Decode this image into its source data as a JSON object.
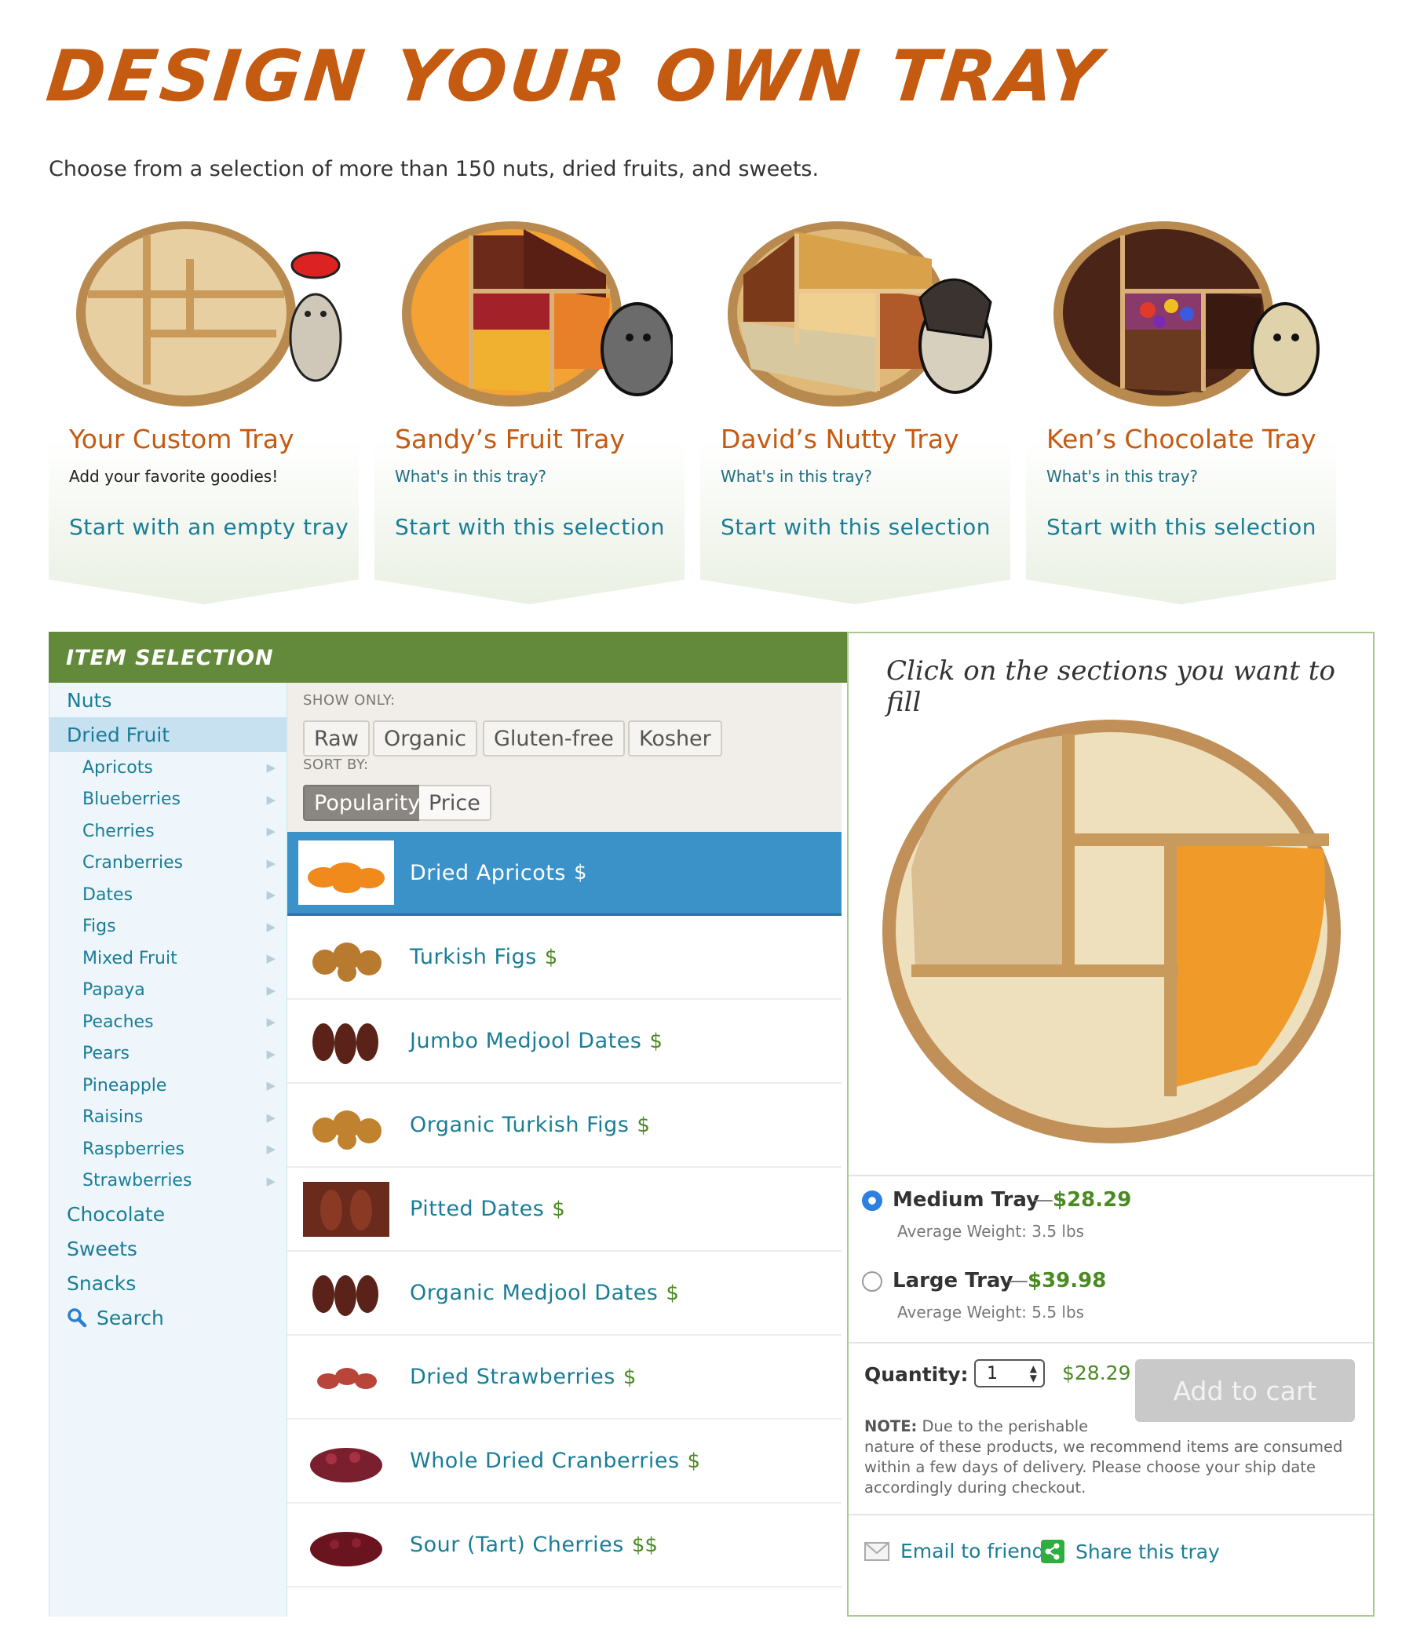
{
  "page": {
    "title": "DESIGN YOUR OWN TRAY",
    "subtitle": "Choose from a selection of more than 150 nuts, dried fruits, and sweets."
  },
  "trays": [
    {
      "title": "Your Custom Tray",
      "sub": "Add your favorite goodies!",
      "link": "Start with an empty tray"
    },
    {
      "title": "Sandy’s Fruit Tray",
      "sub": "What's in this tray?",
      "link": "Start with this selection"
    },
    {
      "title": "David’s Nutty Tray",
      "sub": "What's in this tray?",
      "link": "Start with this selection"
    },
    {
      "title": "Ken’s Chocolate Tray",
      "sub": "What's in this tray?",
      "link": "Start with this selection"
    }
  ],
  "selection": {
    "header": "ITEM SELECTION",
    "categories": {
      "nuts": "Nuts",
      "dried_fruit": "Dried Fruit",
      "chocolate": "Chocolate",
      "sweets": "Sweets",
      "snacks": "Snacks",
      "search": "Search"
    },
    "subcategories": [
      "Apricots",
      "Blueberries",
      "Cherries",
      "Cranberries",
      "Dates",
      "Figs",
      "Mixed Fruit",
      "Papaya",
      "Peaches",
      "Pears",
      "Pineapple",
      "Raisins",
      "Raspberries",
      "Strawberries"
    ],
    "show_only_label": "SHOW ONLY:",
    "filters": [
      "Raw",
      "Organic",
      "Gluten-free",
      "Kosher"
    ],
    "sort_label": "SORT BY:",
    "sort_options": [
      "Popularity",
      "Price"
    ],
    "products": [
      {
        "name": "Dried Apricots",
        "price": "$",
        "color": "#f08a1c"
      },
      {
        "name": "Turkish Figs",
        "price": "$",
        "color": "#b87a2e"
      },
      {
        "name": "Jumbo Medjool Dates",
        "price": "$",
        "color": "#5a2218"
      },
      {
        "name": "Organic Turkish Figs",
        "price": "$",
        "color": "#c0822e"
      },
      {
        "name": "Pitted Dates",
        "price": "$",
        "color": "#6a2a1c"
      },
      {
        "name": "Organic Medjool Dates",
        "price": "$",
        "color": "#5a2218"
      },
      {
        "name": "Dried Strawberries",
        "price": "$",
        "color": "#b8443a"
      },
      {
        "name": "Whole Dried Cranberries",
        "price": "$",
        "color": "#7a1f2e"
      },
      {
        "name": "Sour (Tart) Cherries",
        "price": "$$",
        "color": "#6a1420"
      }
    ]
  },
  "builder": {
    "hint": "Click on the sections you want to fill",
    "medium": {
      "name": "Medium Tray",
      "dash": "—",
      "price": "$28.29",
      "weight": "Average Weight: 3.5 lbs",
      "selected": true
    },
    "large": {
      "name": "Large Tray",
      "dash": "—",
      "price": "$39.98",
      "weight": "Average Weight: 5.5 lbs",
      "selected": false
    },
    "quantity_label": "Quantity:",
    "quantity_value": "1",
    "total": "$28.29",
    "add_to_cart": "Add to cart",
    "note_label": "NOTE:",
    "note_first": "Due to the perishable",
    "note_rest": "nature of these products, we recommend items are consumed within a few days of delivery. Please choose your ship date accordingly during checkout.",
    "email": "Email to friend",
    "share": "Share this tray"
  }
}
